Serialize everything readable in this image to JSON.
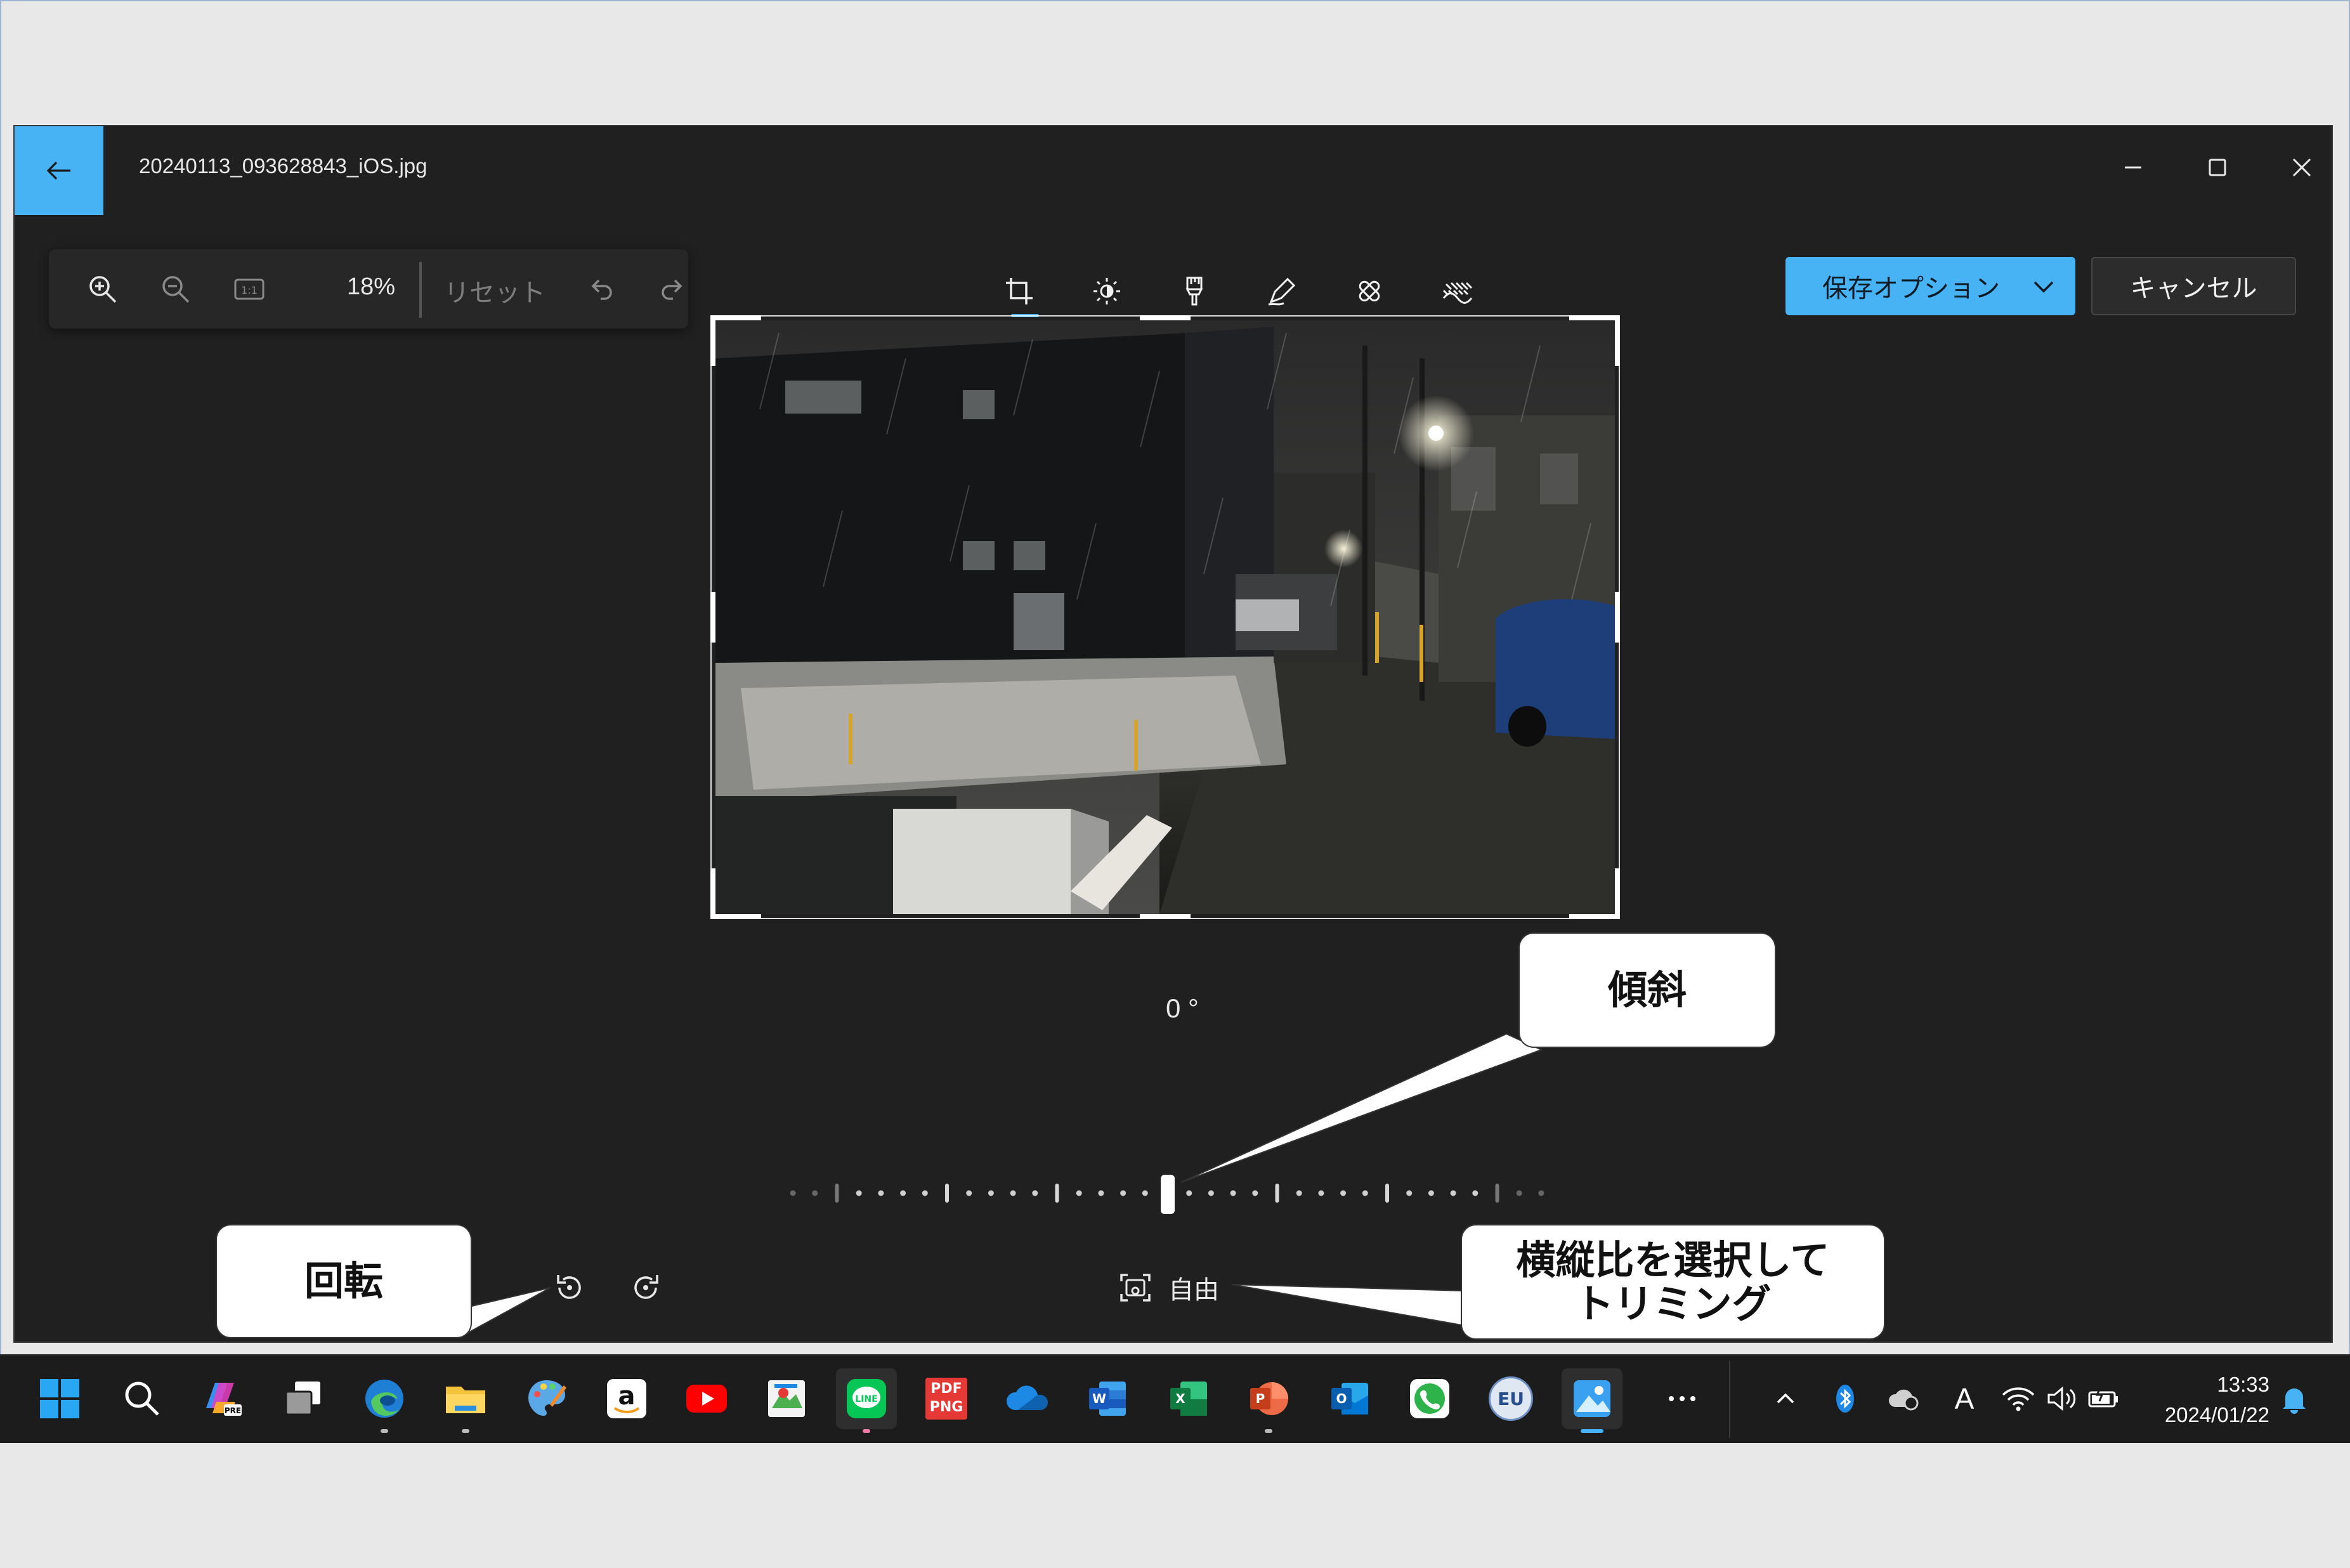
{
  "window": {
    "title": "20240113_093628843_iOS.jpg"
  },
  "toolbar": {
    "zoom_level": "18%",
    "reset_label": "リセット",
    "tools": [
      "crop-icon",
      "brightness-icon",
      "filter-icon",
      "markup-icon",
      "retouch-icon",
      "background-blur-icon"
    ],
    "active_tool": "crop-icon"
  },
  "actions": {
    "save_label": "保存オプション",
    "cancel_label": "キャンセル"
  },
  "crop": {
    "angle_label": "0 °",
    "angle_degrees": 0,
    "aspect_label": "自由"
  },
  "callouts": {
    "tilt": "傾斜",
    "rotate": "回転",
    "aspect_line1": "横縦比を選択して",
    "aspect_line2": "トリミング"
  },
  "taskbar": {
    "time": "13:33",
    "date": "2024/01/22",
    "pdf_icon_text_1": "PDF",
    "pdf_icon_text_2": "PNG",
    "eu_label": "EU",
    "ime_label": "A"
  },
  "colors": {
    "accent": "#47b3f5",
    "app_bg": "#202020",
    "taskbar_bg": "#1c1c1c"
  }
}
